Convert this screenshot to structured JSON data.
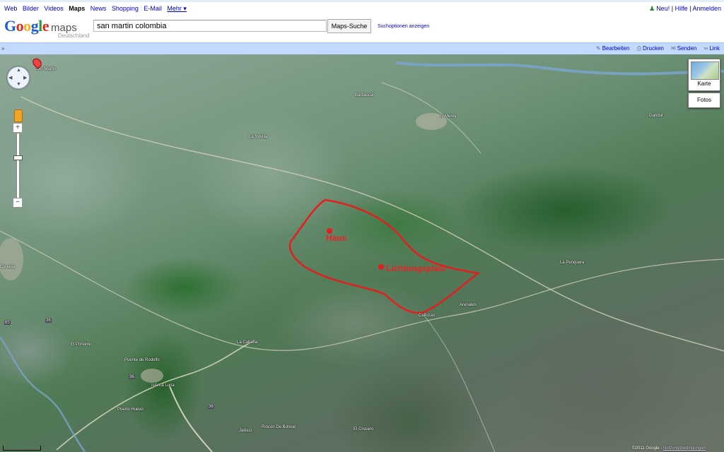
{
  "nav": {
    "left": [
      {
        "label": "Web",
        "active": false
      },
      {
        "label": "Bilder",
        "active": false
      },
      {
        "label": "Videos",
        "active": false
      },
      {
        "label": "Maps",
        "active": true
      },
      {
        "label": "News",
        "active": false
      },
      {
        "label": "Shopping",
        "active": false
      },
      {
        "label": "E-Mail",
        "active": false
      }
    ],
    "more_label": "Mehr ▾",
    "right": {
      "new_label": "Neu!",
      "sep": "|",
      "help_label": "Hilfe",
      "signin_label": "Anmelden"
    }
  },
  "header": {
    "logo_text": "Google",
    "logo_maps": "maps",
    "logo_region": "Deutschland",
    "search_value": "san martin colombia",
    "search_button": "Maps-Suche",
    "options_link": "Suchoptionen anzeigen"
  },
  "toolbar": {
    "collapse": "»",
    "edit": "Bearbeiten",
    "print": "Drucken",
    "send": "Senden",
    "link": "Link"
  },
  "map": {
    "labels": {
      "san_martin": "San Martín",
      "barbascal": "Barbascal",
      "el_merey": "El Merey",
      "la_novilla": "La Novilla",
      "gandul": "Gandul",
      "la_penquera": "La Penquera",
      "arenales": "Arenales",
      "callozas": "Callozas",
      "la_cabana": "La Cabaña",
      "el_porvenir": "El Porvenir",
      "puente_de_rodolfo": "Puente de Rodolfo",
      "isla_la_luna": "Isla La Luna",
      "puerto_huevo": "Puerto Huevo",
      "rincon_de_bolivar": "Rincón De Bolívar",
      "el_crucero": "El Crucero",
      "jalisco": "Jalisco",
      "canada": "Canada",
      "route_65": "65",
      "route_36a": "36",
      "route_36b": "36",
      "route_36c": "36"
    },
    "annotations": {
      "house": "Haus",
      "clearing": "Lichtungsplatz"
    },
    "annotation_color": "#e41e1e",
    "river_color": "#7aa3c9"
  },
  "controls": {
    "map_type": "Karte",
    "photos": "Fotos",
    "zoom_in": "+",
    "zoom_out": "−",
    "zoom_level_fraction": 0.35
  },
  "copyright": {
    "text": "©2011 Google -",
    "terms": "Nutzungsbedingungen"
  }
}
